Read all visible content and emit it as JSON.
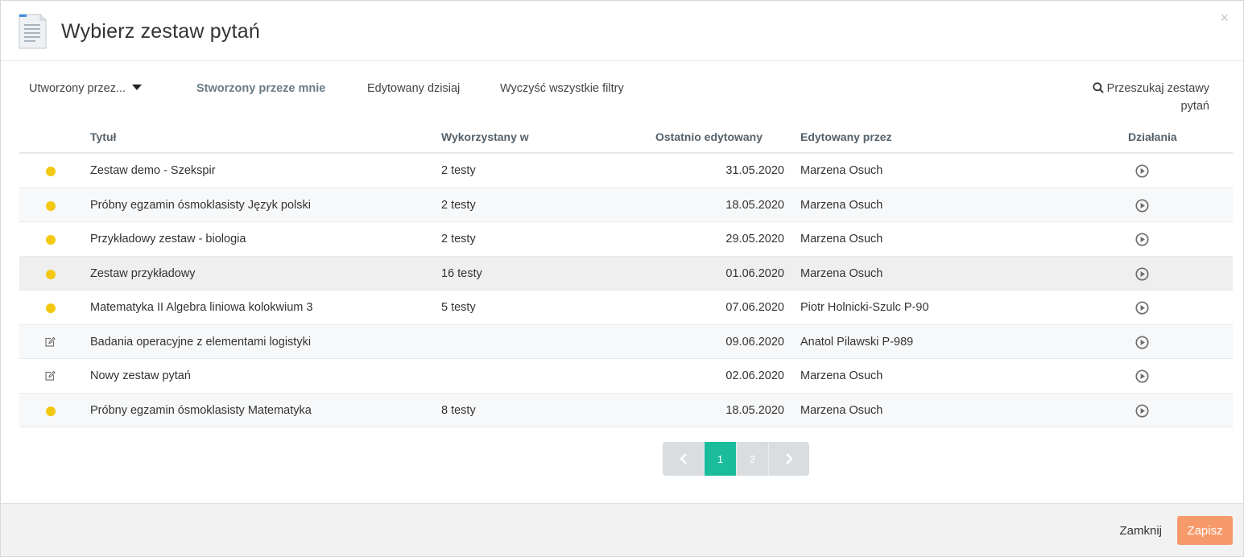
{
  "dialog": {
    "title": "Wybierz zestaw pytań",
    "close_glyph": "×"
  },
  "filters": {
    "created_by_dropdown": "Utworzony przez...",
    "created_by_me": "Stworzony przeze mnie",
    "edited_today": "Edytowany dzisiaj",
    "clear_all": "Wyczyść wszystkie filtry",
    "search_line1": "Przeszukaj zestawy",
    "search_line2": "pytań"
  },
  "table": {
    "headers": {
      "title": "Tytuł",
      "used_in": "Wykorzystany w",
      "last_edited": "Ostatnio edytowany",
      "edited_by": "Edytowany przez",
      "actions": "Działania"
    },
    "rows": [
      {
        "status": "dot",
        "title": "Zestaw demo - Szekspir",
        "used_in": "2 testy",
        "last_edited": "31.05.2020",
        "edited_by": "Marzena Osuch"
      },
      {
        "status": "dot",
        "title": "Próbny egzamin ósmoklasisty Język polski",
        "used_in": "2 testy",
        "last_edited": "18.05.2020",
        "edited_by": "Marzena Osuch"
      },
      {
        "status": "dot",
        "title": "Przykładowy zestaw - biologia",
        "used_in": "2 testy",
        "last_edited": "29.05.2020",
        "edited_by": "Marzena Osuch"
      },
      {
        "status": "dot",
        "title": "Zestaw przykładowy",
        "used_in": "16 testy",
        "last_edited": "01.06.2020",
        "edited_by": "Marzena Osuch"
      },
      {
        "status": "dot",
        "title": "Matematyka II Algebra liniowa kolokwium 3",
        "used_in": "5 testy",
        "last_edited": "07.06.2020",
        "edited_by": "Piotr Holnicki-Szulc P-90"
      },
      {
        "status": "edit",
        "title": "Badania operacyjne z elementami logistyki",
        "used_in": "",
        "last_edited": "09.06.2020",
        "edited_by": "Anatol Pilawski P-989"
      },
      {
        "status": "edit",
        "title": "Nowy zestaw pytań",
        "used_in": "",
        "last_edited": "02.06.2020",
        "edited_by": "Marzena Osuch"
      },
      {
        "status": "dot",
        "title": "Próbny egzamin ósmoklasisty Matematyka",
        "used_in": "8 testy",
        "last_edited": "18.05.2020",
        "edited_by": "Marzena Osuch"
      }
    ]
  },
  "pagination": {
    "pages": [
      "1",
      "2"
    ],
    "current": "1"
  },
  "footer": {
    "close_label": "Zamknij",
    "save_label": "Zapisz"
  },
  "colors": {
    "status_dot": "#f2c811",
    "pager_active": "#1abc9c",
    "save_button": "#f79a6b"
  },
  "icons": {
    "header": "document-icon",
    "status_published": "yellow-dot",
    "status_draft": "edit-icon",
    "action": "play-circle-icon",
    "search": "search-icon"
  }
}
